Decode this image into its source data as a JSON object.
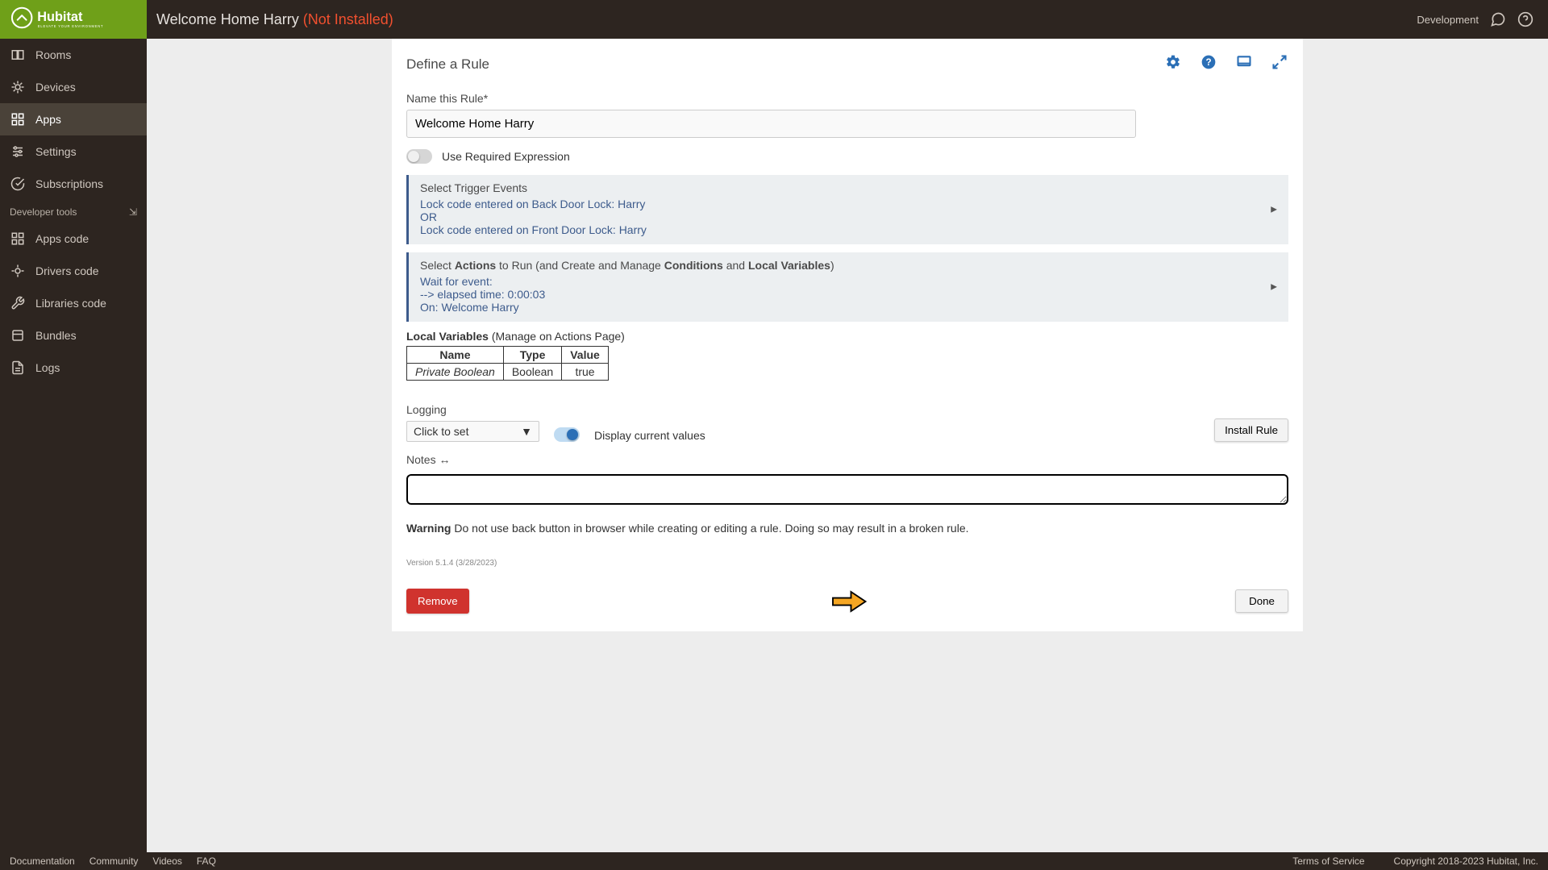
{
  "header": {
    "title": "Welcome Home Harry",
    "status": "(Not Installed)",
    "dev_label": "Development"
  },
  "sidebar": {
    "items": [
      {
        "label": "Rooms"
      },
      {
        "label": "Devices"
      },
      {
        "label": "Apps"
      },
      {
        "label": "Settings"
      },
      {
        "label": "Subscriptions"
      }
    ],
    "dev_tools_label": "Developer tools",
    "dev_items": [
      {
        "label": "Apps code"
      },
      {
        "label": "Drivers code"
      },
      {
        "label": "Libraries code"
      },
      {
        "label": "Bundles"
      },
      {
        "label": "Logs"
      }
    ]
  },
  "form": {
    "section_title": "Define a Rule",
    "name_label": "Name this Rule*",
    "name_value": "Welcome Home Harry",
    "use_required_expr": "Use Required Expression",
    "triggers": {
      "title": "Select Trigger Events",
      "line1": "Lock code entered on Back Door Lock: Harry",
      "or": "OR",
      "line2": "Lock code entered on Front Door Lock: Harry"
    },
    "actions": {
      "prefix": "Select ",
      "actions_bold": "Actions",
      "mid1": " to Run (and Create and Manage ",
      "conditions_bold": "Conditions",
      "mid2": " and ",
      "localvars_bold": "Local Variables",
      "suffix": ")",
      "line1": "Wait for event:",
      "line2": " --> elapsed time: 0:00:03",
      "line3": "On: Welcome Harry"
    },
    "local_vars": {
      "label_bold": "Local Variables",
      "label_rest": " (Manage on Actions Page)",
      "headers": {
        "name": "Name",
        "type": "Type",
        "value": "Value"
      },
      "rows": [
        {
          "name": "Private Boolean",
          "type": "Boolean",
          "value": "true"
        }
      ]
    },
    "logging": {
      "label": "Logging",
      "select_placeholder": "Click to set",
      "display_current": "Display current values",
      "install_btn": "Install Rule"
    },
    "notes_label": "Notes ",
    "notes_arrow": "↔",
    "warning_bold": "Warning",
    "warning_text": " Do not use back button in browser while creating or editing a rule. Doing so may result in a broken rule.",
    "version": "Version 5.1.4 (3/28/2023)",
    "remove_btn": "Remove",
    "done_btn": "Done"
  },
  "footer": {
    "links": [
      "Documentation",
      "Community",
      "Videos",
      "FAQ"
    ],
    "tos": "Terms of Service",
    "copyright": "Copyright 2018-2023 Hubitat, Inc."
  }
}
